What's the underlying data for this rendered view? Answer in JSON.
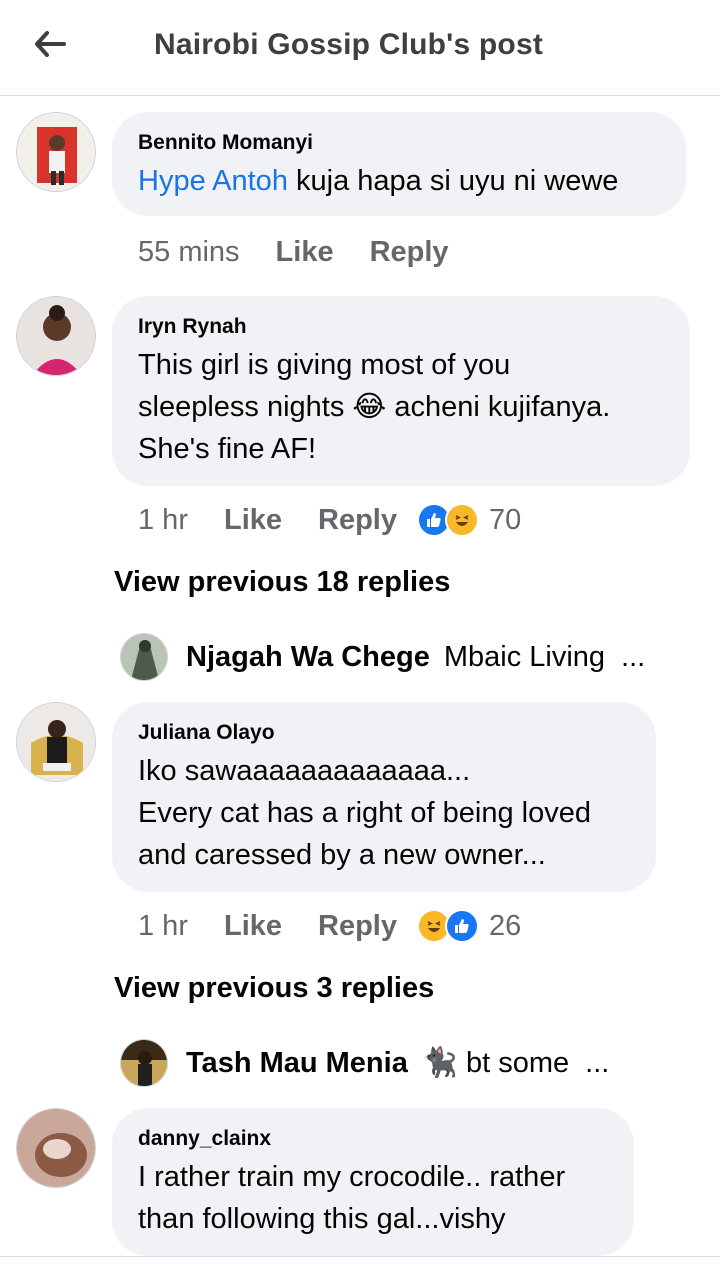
{
  "header": {
    "title": "Nairobi Gossip Club's post",
    "back_icon": "arrow-left-icon"
  },
  "comments": [
    {
      "author": "Bennito Momanyi",
      "mention": "Hype Antoh",
      "text": " kuja hapa si uyu ni wewe",
      "time": "55 mins",
      "like_label": "Like",
      "reply_label": "Reply"
    },
    {
      "author": "Iryn Rynah",
      "text_lines": [
        "This girl is giving most of you",
        "sleepless nights 😂 acheni kujifanya.",
        "She's fine AF!"
      ],
      "time": "1 hr",
      "like_label": "Like",
      "reply_label": "Reply",
      "reactions": [
        "like-reaction-icon",
        "haha-reaction-icon"
      ],
      "reaction_count": "70"
    },
    {
      "author": "Juliana Olayo",
      "text_lines": [
        "Iko sawaaaaaaaaaaaaa...",
        "Every cat has a right of being loved",
        "and caressed by a new owner..."
      ],
      "time": "1 hr",
      "like_label": "Like",
      "reply_label": "Reply",
      "reactions": [
        "haha-reaction-icon",
        "like-reaction-icon"
      ],
      "reaction_count": "26"
    },
    {
      "author": "danny_clainx",
      "text_lines": [
        "I rather train my crocodile.. rather",
        "than following this gal...vishy"
      ]
    }
  ],
  "threads": [
    {
      "view_previous": "View previous 18 replies",
      "reply_author": "Njagah Wa Chege",
      "reply_snippet": "Mbaic Living",
      "ellipsis": "..."
    },
    {
      "view_previous": "View previous 3 replies",
      "reply_author": "Tash Mau Menia",
      "reply_snippet": "🐈‍⬛ bt some",
      "ellipsis": "..."
    }
  ],
  "colors": {
    "mention": "#1b74e4",
    "bubble": "#f0f2f5",
    "meta": "#65676b",
    "like_blue": "#1877f2",
    "haha_yellow": "#f7b928"
  }
}
